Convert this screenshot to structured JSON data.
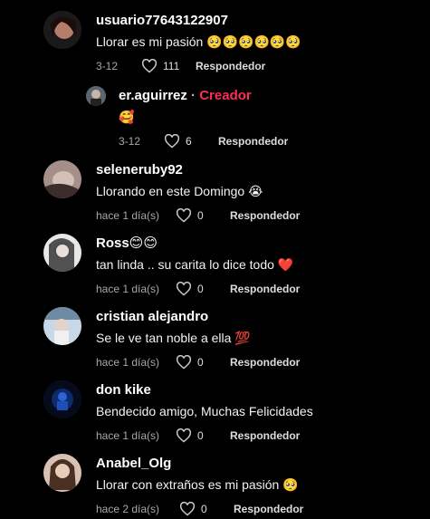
{
  "comments": [
    {
      "username": "usuario77643122907",
      "text": "Llorar es mi pasión 🥺🥺🥺🥺🥺🥺",
      "date": "3-12",
      "likes": "111",
      "reply_label": "Respondedor"
    },
    {
      "username": "er.aguirrez",
      "separator": "·",
      "creator_label": "Creador",
      "text": "🥰",
      "date": "3-12",
      "likes": "6",
      "reply_label": "Respondedor"
    },
    {
      "username": "seleneruby92",
      "text": "Llorando en este Domingo 😭",
      "date": "hace 1 día(s)",
      "likes": "0",
      "reply_label": "Respondedor"
    },
    {
      "username": "Ross😊😊",
      "text": "tan linda .. su carita lo dice todo ❤️",
      "date": "hace 1 día(s)",
      "likes": "0",
      "reply_label": "Respondedor"
    },
    {
      "username": "cristian alejandro",
      "text": "Se le ve tan noble a ella 💯",
      "date": "hace 1 día(s)",
      "likes": "0",
      "reply_label": "Respondedor"
    },
    {
      "username": "don kike",
      "text": "Bendecido amigo, Muchas Felicidades",
      "date": "hace 1 día(s)",
      "likes": "0",
      "reply_label": "Respondedor"
    },
    {
      "username": "Anabel_Olg",
      "text": "Llorar con extraños es mi pasión 🥺",
      "date": "hace 2 día(s)",
      "likes": "0",
      "reply_label": "Respondedor"
    }
  ],
  "icons": {
    "avatar": "user-avatar",
    "like": "heart-outline-icon"
  }
}
